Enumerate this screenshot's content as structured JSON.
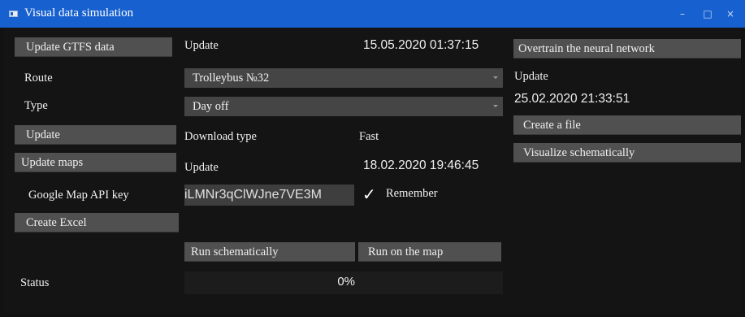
{
  "window": {
    "title": "Visual data simulation",
    "controls": {
      "minimize": "–",
      "maximize": "□",
      "close": "×"
    }
  },
  "left": {
    "update_gtfs_button": "Update GTFS data",
    "route_label": "Route",
    "type_label": "Type",
    "update_button": "Update",
    "update_maps_button": "Update maps",
    "api_key_label": "Google Map API key",
    "create_excel_button": "Create Excel",
    "status_label": "Status"
  },
  "middle": {
    "gtfs_update_label": "Update",
    "gtfs_update_time": "15.05.2020 01:37:15",
    "route_select": {
      "value": "Trolleybus №32"
    },
    "type_select": {
      "value": "Day off"
    },
    "download_type_label": "Download type",
    "download_type_value": "Fast",
    "maps_update_label": "Update",
    "maps_update_time": "18.02.2020 19:46:45",
    "api_key_value": "iLMNr3qClWJne7VE3M",
    "remember_label": "Remember",
    "remember_checked": true,
    "run_schematically_button": "Run schematically",
    "run_on_map_button": "Run on the map",
    "progress_value": 0,
    "progress_text": "0%"
  },
  "right": {
    "overtrain_button": "Overtrain the neural network",
    "update_label": "Update",
    "update_time": "25.02.2020 21:33:51",
    "create_file_button": "Create a file",
    "visualize_button": "Visualize schematically"
  },
  "icons": {
    "app_icon": "window-app-icon",
    "checkmark": "checkmark-icon",
    "dropdown": "chevron-down-icon"
  },
  "colors": {
    "titlebar": "#1760cf",
    "background": "#141414",
    "button": "#505050"
  }
}
